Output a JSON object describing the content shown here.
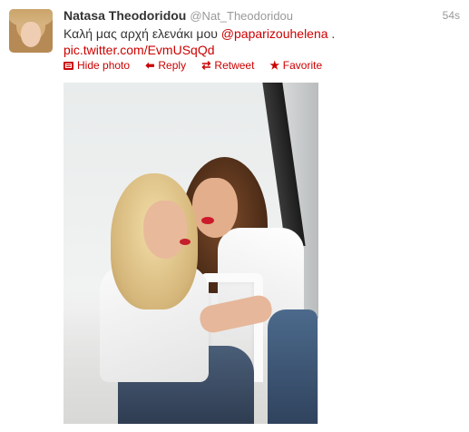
{
  "tweet": {
    "fullname": "Natasa Theodoridou",
    "username": "@Nat_Theodoridou",
    "timestamp": "54s",
    "text": "Καλή μας αρχή ελενάκι μου ",
    "mention": "@paparizouhelena",
    "text_after_mention": " .",
    "link": "pic.twitter.com/EvmUSqQd",
    "actions": [
      {
        "label": "Hide photo",
        "icon": "photo-icon"
      },
      {
        "label": "Reply",
        "icon": "reply-icon"
      },
      {
        "label": "Retweet",
        "icon": "retweet-icon"
      },
      {
        "label": "Favorite",
        "icon": "star-icon"
      }
    ]
  },
  "colors": {
    "link": "#cc0000",
    "meta": "#999999",
    "text": "#333333"
  }
}
